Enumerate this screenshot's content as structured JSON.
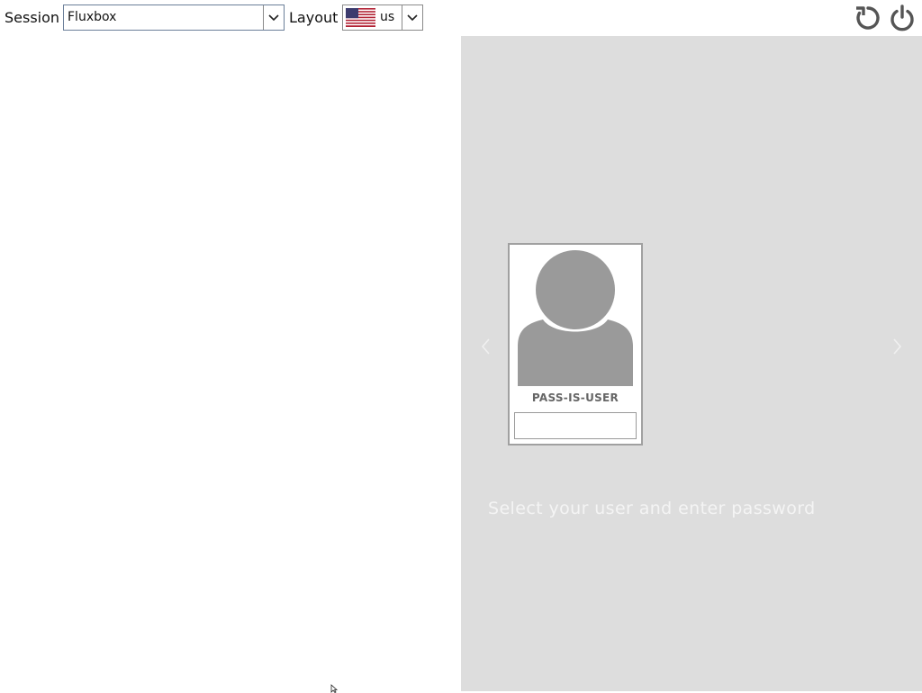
{
  "topbar": {
    "session_label": "Session",
    "session_value": "Fluxbox",
    "layout_label": "Layout",
    "layout_value": "us",
    "layout_flag_icon": "us-flag-icon",
    "reboot_icon": "reboot-icon",
    "power_icon": "power-icon"
  },
  "login_panel": {
    "background_color": "#dddddd",
    "user_card": {
      "username": "PASS-IS-USER",
      "avatar_icon": "user-avatar-icon",
      "password_value": ""
    },
    "hint": "Select your user and enter password",
    "prev_icon": "chevron-left-icon",
    "next_icon": "chevron-right-icon"
  }
}
